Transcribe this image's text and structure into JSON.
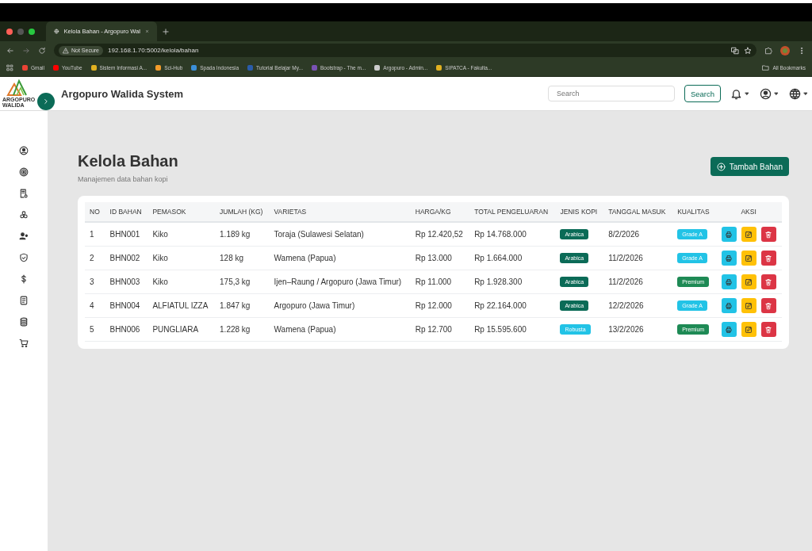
{
  "browser": {
    "tab": {
      "title": "Kelola Bahan - Argopuro Wal",
      "selected": true
    },
    "security": "Not Secure",
    "url": "192.168.1.70:5002/kelola/bahan",
    "bookmarks": [
      {
        "label": "Gmail",
        "color": "#ea4335"
      },
      {
        "label": "YouTube",
        "color": "#ff0000"
      },
      {
        "label": "Sistem Informasi A...",
        "color": "#e0b020"
      },
      {
        "label": "Sci-Hub",
        "color": "#f29b2b"
      },
      {
        "label": "Spada Indonesia",
        "color": "#3b8fd8"
      },
      {
        "label": "Tutorial Belajar My...",
        "color": "#2a5caa"
      },
      {
        "label": "Bootstrap - The m...",
        "color": "#7952b3"
      },
      {
        "label": "Argopuro - Admin...",
        "color": "#cccccc"
      },
      {
        "label": "SIPATCA - Fakulta...",
        "color": "#e0b020"
      }
    ],
    "all_bookmarks": "All Bookmarks"
  },
  "app": {
    "logo_lines": [
      "ARGOPURO",
      "WALIDA"
    ],
    "title": "Argopuro Walida System",
    "search": {
      "placeholder": "Search",
      "button": "Search"
    }
  },
  "page": {
    "title": "Kelola Bahan",
    "subtitle": "Manajemen data bahan kopi",
    "add_button": "Tambah Bahan"
  },
  "table": {
    "columns": [
      "NO",
      "ID BAHAN",
      "PEMASOK",
      "JUMLAH (KG)",
      "VARIETAS",
      "HARGA/KG",
      "TOTAL PENGELUARAN",
      "JENIS KOPI",
      "TANGGAL MASUK",
      "KUALITAS",
      "AKSI"
    ],
    "rows": [
      {
        "no": "1",
        "id": "BHN001",
        "pemasok": "Kiko",
        "jumlah": "1.189 kg",
        "varietas": "Toraja (Sulawesi Selatan)",
        "harga": "Rp 12.420,52",
        "total": "Rp 14.768.000",
        "jenis": {
          "label": "Arabica",
          "color": "#0b6b57"
        },
        "tanggal": "8/2/2026",
        "kualitas": {
          "label": "Grade A",
          "color": "#22c3e6"
        }
      },
      {
        "no": "2",
        "id": "BHN002",
        "pemasok": "Kiko",
        "jumlah": "128 kg",
        "varietas": "Wamena (Papua)",
        "harga": "Rp 13.000",
        "total": "Rp 1.664.000",
        "jenis": {
          "label": "Arabica",
          "color": "#0b6b57"
        },
        "tanggal": "11/2/2026",
        "kualitas": {
          "label": "Grade A",
          "color": "#22c3e6"
        }
      },
      {
        "no": "3",
        "id": "BHN003",
        "pemasok": "Kiko",
        "jumlah": "175,3 kg",
        "varietas": "Ijen–Raung / Argopuro (Jawa Timur)",
        "harga": "Rp 11.000",
        "total": "Rp 1.928.300",
        "jenis": {
          "label": "Arabica",
          "color": "#0b6b57"
        },
        "tanggal": "11/2/2026",
        "kualitas": {
          "label": "Premium",
          "color": "#1e8a55"
        }
      },
      {
        "no": "4",
        "id": "BHN004",
        "pemasok": "ALFIATUL IZZA",
        "jumlah": "1.847 kg",
        "varietas": "Argopuro (Jawa Timur)",
        "harga": "Rp 12.000",
        "total": "Rp 22.164.000",
        "jenis": {
          "label": "Arabica",
          "color": "#0b6b57"
        },
        "tanggal": "12/2/2026",
        "kualitas": {
          "label": "Grade A",
          "color": "#22c3e6"
        }
      },
      {
        "no": "5",
        "id": "BHN006",
        "pemasok": "PUNGLIARA",
        "jumlah": "1.228 kg",
        "varietas": "Wamena (Papua)",
        "harga": "Rp 12.700",
        "total": "Rp 15.595.600",
        "jenis": {
          "label": "Robusta",
          "color": "#22c3e6"
        },
        "tanggal": "13/2/2026",
        "kualitas": {
          "label": "Premium",
          "color": "#1e8a55"
        }
      }
    ]
  }
}
